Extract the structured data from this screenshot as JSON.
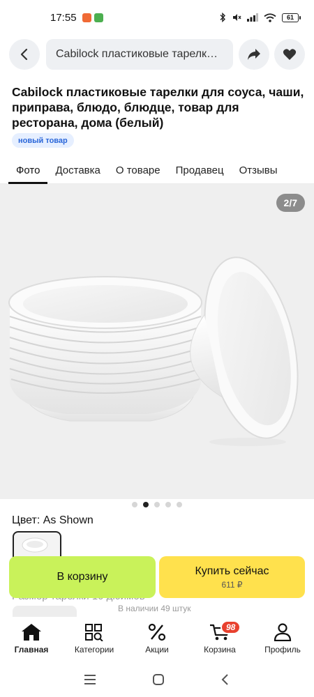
{
  "status_bar": {
    "time": "17:55",
    "battery": "61",
    "app_icon_colors": [
      "#f06a35",
      "#4caf50"
    ]
  },
  "search": {
    "query": "Cabilock пластиковые тарелки для соуса"
  },
  "icons": {
    "back": "chevron-left-icon",
    "share": "share-arrow-icon",
    "favorite": "heart-icon"
  },
  "product": {
    "title": "Cabilock пластиковые тарелки для соуса, чаши, приправа, блюдо, блюдце, товар для ресторана, дома (белый)",
    "badge": "новый товар"
  },
  "tabs": [
    {
      "label": "Фото",
      "active": true
    },
    {
      "label": "Доставка",
      "active": false
    },
    {
      "label": "О товаре",
      "active": false
    },
    {
      "label": "Продавец",
      "active": false
    },
    {
      "label": "Отзывы",
      "active": false
    }
  ],
  "gallery": {
    "counter": "2/7",
    "total_images": 7,
    "current_index": 2,
    "visible_dots": 5,
    "active_dot": 1
  },
  "color": {
    "label": "Цвет: As Shown"
  },
  "size": {
    "label": "Размер тарелки 10 дюймов",
    "stock": "В наличии 49 штук"
  },
  "actions": {
    "cart_label": "В корзину",
    "buy_label": "Купить сейчас",
    "buy_price": "611 ₽"
  },
  "bottom_nav": [
    {
      "label": "Главная",
      "icon": "home-icon",
      "active": true
    },
    {
      "label": "Категории",
      "icon": "categories-icon",
      "active": false
    },
    {
      "label": "Акции",
      "icon": "percent-icon",
      "active": false
    },
    {
      "label": "Корзина",
      "icon": "cart-icon",
      "active": false,
      "badge": "98"
    },
    {
      "label": "Профиль",
      "icon": "profile-icon",
      "active": false
    }
  ],
  "colors": {
    "accent_green": "#c9f25a",
    "accent_yellow": "#ffe14d",
    "badge_red": "#e8412f",
    "badge_blue_text": "#2a66d9"
  }
}
